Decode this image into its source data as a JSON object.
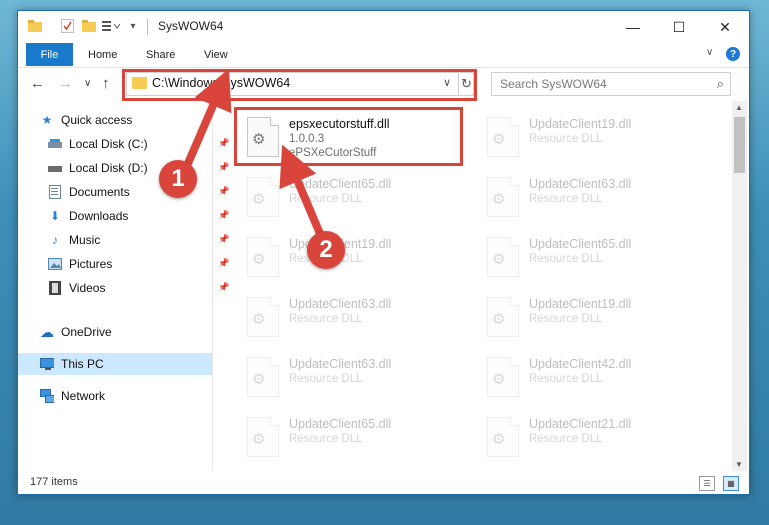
{
  "window": {
    "title": "SysWOW64",
    "minimize_glyph": "—",
    "maximize_glyph": "☐",
    "close_glyph": "✕"
  },
  "ribbon": {
    "tabs": [
      "File",
      "Home",
      "Share",
      "View"
    ],
    "collapse_glyph": "∨",
    "help_glyph": "?"
  },
  "navigation": {
    "back_glyph": "←",
    "forward_glyph": "→",
    "recent_glyph": "∨",
    "up_glyph": "↑",
    "address_path": "C:\\Windows\\SysWOW64",
    "address_dropdown_glyph": "∨",
    "refresh_glyph": "↻",
    "search_placeholder": "Search SysWOW64",
    "search_glyph": "⌕"
  },
  "sidebar": {
    "items": [
      {
        "label": "Quick access",
        "icon": "star-icon",
        "glyph": "★",
        "color": "#2d7fd3"
      },
      {
        "label": "Local Disk (C:)",
        "icon": "drive-icon",
        "glyph": "▬",
        "color": "#5a7fa0"
      },
      {
        "label": "Local Disk (D:)",
        "icon": "drive-icon",
        "glyph": "▬",
        "color": "#6b6b6b"
      },
      {
        "label": "Documents",
        "icon": "documents-icon",
        "glyph": "▤",
        "color": "#5a7fa0"
      },
      {
        "label": "Downloads",
        "icon": "downloads-icon",
        "glyph": "⬇",
        "color": "#2d7fd3"
      },
      {
        "label": "Music",
        "icon": "music-icon",
        "glyph": "♪",
        "color": "#2d7fd3"
      },
      {
        "label": "Pictures",
        "icon": "pictures-icon",
        "glyph": "▣",
        "color": "#4f86b5"
      },
      {
        "label": "Videos",
        "icon": "videos-icon",
        "glyph": "▦",
        "color": "#555"
      },
      {
        "label": "OneDrive",
        "icon": "cloud-icon",
        "glyph": "☁",
        "color": "#1e6fc4"
      },
      {
        "label": "This PC",
        "icon": "computer-icon",
        "glyph": "▭",
        "color": "#2d7fd3"
      },
      {
        "label": "Network",
        "icon": "network-icon",
        "glyph": "⇄",
        "color": "#2d7fd3"
      }
    ],
    "pin_glyph": "📌"
  },
  "files": [
    {
      "name": "epsxecutorstuff.dll",
      "line2": "1.0.0.3",
      "line3": "ePSXeCutorStuff"
    },
    {
      "name": "UpdateClient19.dll",
      "line2": "Resource DLL",
      "line3": ""
    },
    {
      "name": "UpdateClient65.dll",
      "line2": "Resource DLL",
      "line3": ""
    },
    {
      "name": "UpdateClient63.dll",
      "line2": "Resource DLL",
      "line3": ""
    },
    {
      "name": "UpdateClient19.dll",
      "line2": "Resource DLL",
      "line3": ""
    },
    {
      "name": "UpdateClient65.dll",
      "line2": "Resource DLL",
      "line3": ""
    },
    {
      "name": "UpdateClient63.dll",
      "line2": "Resource DLL",
      "line3": ""
    },
    {
      "name": "UpdateClient19.dll",
      "line2": "Resource DLL",
      "line3": ""
    },
    {
      "name": "UpdateClient63.dll",
      "line2": "Resource DLL",
      "line3": ""
    },
    {
      "name": "UpdateClient42.dll",
      "line2": "Resource DLL",
      "line3": ""
    },
    {
      "name": "UpdateClient65.dll",
      "line2": "Resource DLL",
      "line3": ""
    },
    {
      "name": "UpdateClient21.dll",
      "line2": "Resource DLL",
      "line3": ""
    }
  ],
  "status": {
    "item_count": "177 items"
  },
  "annotations": {
    "callout1": "1",
    "callout2": "2",
    "color": "#d9443b"
  }
}
